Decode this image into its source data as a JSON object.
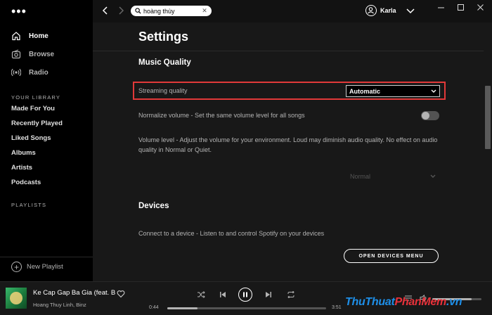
{
  "sidebar": {
    "nav": [
      {
        "label": "Home",
        "icon": "home-icon"
      },
      {
        "label": "Browse",
        "icon": "radio-box-icon"
      },
      {
        "label": "Radio",
        "icon": "radio-waves-icon"
      }
    ],
    "library_title": "YOUR LIBRARY",
    "library_items": [
      "Made For You",
      "Recently Played",
      "Liked Songs",
      "Albums",
      "Artists",
      "Podcasts"
    ],
    "playlists_title": "PLAYLISTS",
    "new_playlist_label": "New Playlist"
  },
  "topbar": {
    "search_value": "hoàng thùy",
    "user_name": "Karla"
  },
  "settings": {
    "title": "Settings",
    "music_quality_heading": "Music Quality",
    "streaming_quality_label": "Streaming quality",
    "streaming_quality_value": "Automatic",
    "normalize_label": "Normalize volume - Set the same volume level for all songs",
    "normalize_enabled": false,
    "volume_level_label": "Volume level - Adjust the volume for your environment. Loud may diminish audio quality. No effect on audio quality in Normal or Quiet.",
    "volume_level_value": "Normal",
    "devices_heading": "Devices",
    "devices_label": "Connect to a device - Listen to and control Spotify on your devices",
    "open_devices_button": "OPEN DEVICES MENU"
  },
  "player": {
    "track_title": "Ke Cap Gap Ba Gia (feat. B",
    "track_artist": "Hoang Thuy Linh, Binz",
    "elapsed": "0:44",
    "duration": "3:51",
    "progress_fraction": 0.19,
    "volume_fraction": 0.8
  },
  "watermark": {
    "part1": "Thu",
    "part2": "Thuat",
    "part3": "PhanMem",
    "part4": ".vn"
  },
  "colors": {
    "highlight_border": "#e13939",
    "background": "#181818",
    "sidebar_bg": "#000000"
  }
}
